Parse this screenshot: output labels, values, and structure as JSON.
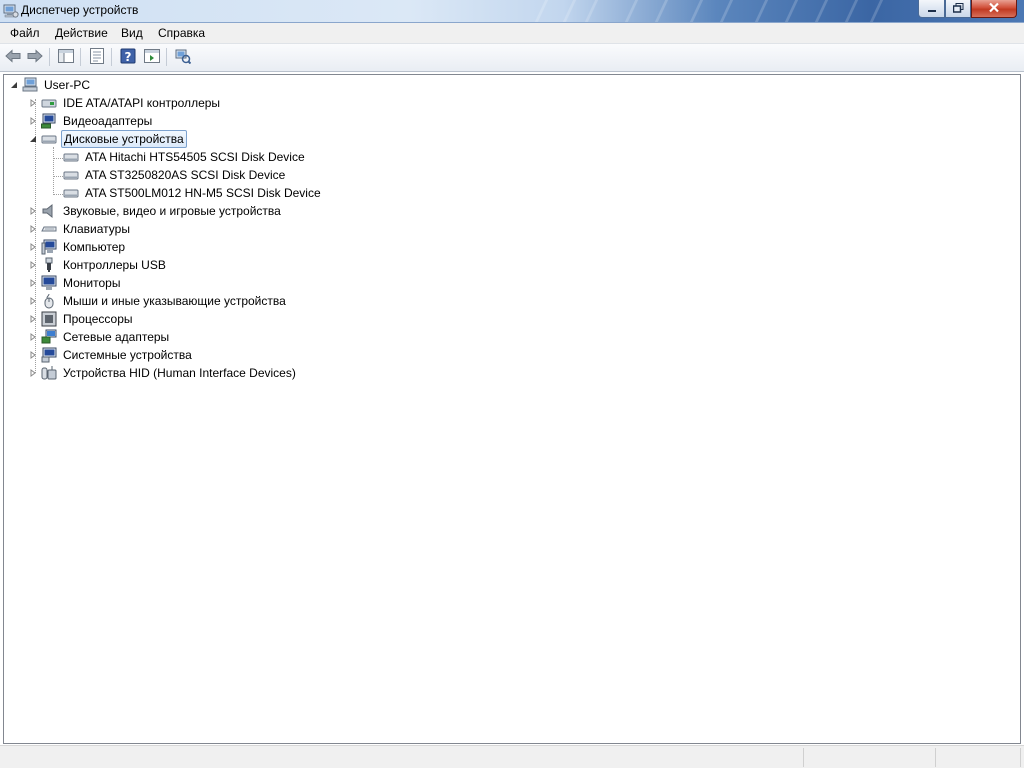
{
  "window": {
    "title": "Диспетчер устройств",
    "icons": {
      "app": "device-manager-icon",
      "minimize": "minimize-icon",
      "maximize": "restore-icon",
      "close": "close-icon"
    }
  },
  "menu": {
    "items": [
      "Файл",
      "Действие",
      "Вид",
      "Справка"
    ]
  },
  "toolbar": {
    "buttons": [
      "back-arrow-icon",
      "forward-arrow-icon",
      "show-hide-tree-icon",
      "properties-icon",
      "help-icon",
      "action-pane-icon",
      "scan-hardware-icon"
    ]
  },
  "tree": {
    "root": {
      "label": "User-PC",
      "icon": "computer-icon",
      "expanded": true
    },
    "categories": [
      {
        "label": "IDE ATA/ATAPI контроллеры",
        "icon": "ide-controller-icon",
        "expanded": false
      },
      {
        "label": "Видеоадаптеры",
        "icon": "display-adapter-icon",
        "expanded": false
      },
      {
        "label": "Дисковые устройства",
        "icon": "disk-drive-icon",
        "expanded": true,
        "selected": true,
        "children": [
          {
            "label": "ATA Hitachi HTS54505 SCSI Disk Device",
            "icon": "disk-drive-icon"
          },
          {
            "label": "ATA ST3250820AS SCSI Disk Device",
            "icon": "disk-drive-icon"
          },
          {
            "label": "ATA ST500LM012 HN-M5 SCSI Disk Device",
            "icon": "disk-drive-icon"
          }
        ]
      },
      {
        "label": "Звуковые, видео и игровые устройства",
        "icon": "speaker-icon",
        "expanded": false
      },
      {
        "label": "Клавиатуры",
        "icon": "keyboard-icon",
        "expanded": false
      },
      {
        "label": "Компьютер",
        "icon": "computer-monitor-icon",
        "expanded": false
      },
      {
        "label": "Контроллеры USB",
        "icon": "usb-icon",
        "expanded": false
      },
      {
        "label": "Мониторы",
        "icon": "monitor-icon",
        "expanded": false
      },
      {
        "label": "Мыши и иные указывающие устройства",
        "icon": "mouse-icon",
        "expanded": false
      },
      {
        "label": "Процессоры",
        "icon": "processor-icon",
        "expanded": false
      },
      {
        "label": "Сетевые адаптеры",
        "icon": "network-adapter-icon",
        "expanded": false
      },
      {
        "label": "Системные устройства",
        "icon": "system-device-icon",
        "expanded": false
      },
      {
        "label": "Устройства HID (Human Interface Devices)",
        "icon": "hid-icon",
        "expanded": false
      }
    ]
  },
  "colors": {
    "selection_border": "#7da2ce",
    "selection_fill": "#dceafa",
    "titlebar_dark": "#3b66a4"
  }
}
